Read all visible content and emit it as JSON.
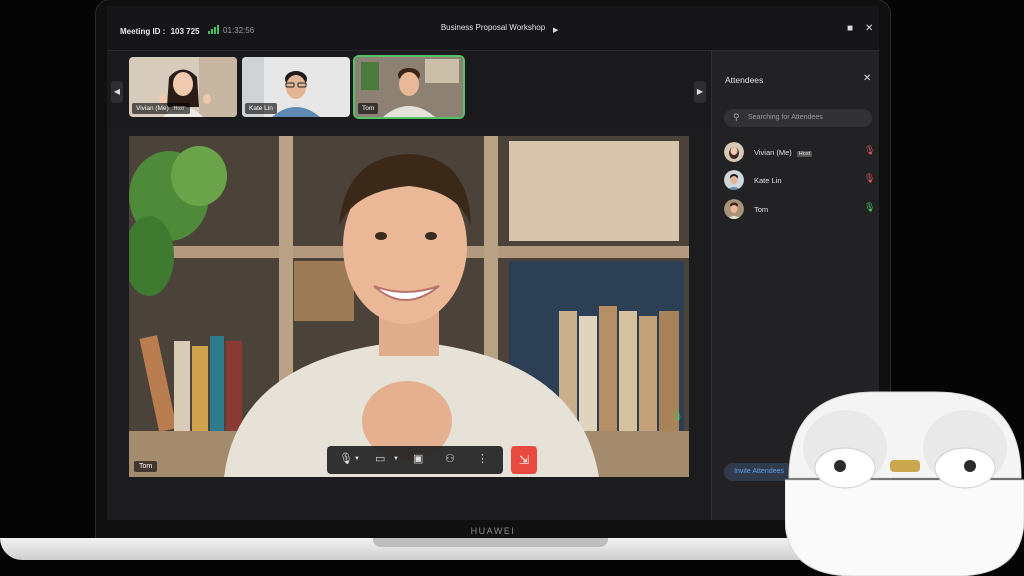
{
  "topbar": {
    "meeting_label": "Meeting ID :",
    "meeting_id": "103 725",
    "timer": "01:32:56",
    "title": "Business Proposal Workshop"
  },
  "thumbnails": [
    {
      "name": "Vivian (Me)",
      "host": "Host",
      "active": false
    },
    {
      "name": "Kate Lin",
      "active": false
    },
    {
      "name": "Tom",
      "active": true
    }
  ],
  "main_video": {
    "speaker": "Tom"
  },
  "sidebar": {
    "title": "Attendees",
    "search_placeholder": "Searching for Attendees",
    "attendees": [
      {
        "name": "Vivian (Me)",
        "host": "Host",
        "mic": "muted"
      },
      {
        "name": "Kate Lin",
        "mic": "muted"
      },
      {
        "name": "Tom",
        "mic": "on"
      }
    ],
    "invite_label": "Invite Attendees"
  },
  "device": {
    "brand": "HUAWEI"
  },
  "colors": {
    "accent_green": "#53c26a",
    "end_call": "#e84a3f",
    "link_blue": "#5ea2f2"
  }
}
